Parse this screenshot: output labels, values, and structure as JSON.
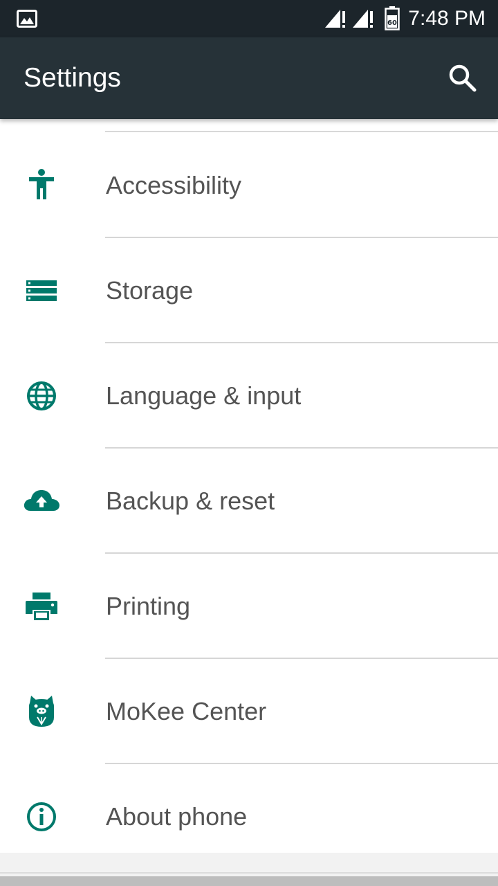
{
  "status_bar": {
    "time": "7:48 PM",
    "battery_label": "60",
    "icons": [
      "gallery-icon",
      "signal-no-data-icon",
      "signal-no-data-icon",
      "battery-icon"
    ]
  },
  "app_bar": {
    "title": "Settings",
    "search_icon": "search-icon"
  },
  "colors": {
    "status_bar": "#1c252b",
    "app_bar": "#263238",
    "icon_tint": "#00796b",
    "text": "#545454",
    "background": "#ffffff"
  },
  "settings": {
    "items": [
      {
        "label": "Accessibility",
        "icon": "accessibility-icon"
      },
      {
        "label": "Storage",
        "icon": "storage-icon"
      },
      {
        "label": "Language & input",
        "icon": "globe-icon"
      },
      {
        "label": "Backup & reset",
        "icon": "cloud-upload-icon"
      },
      {
        "label": "Printing",
        "icon": "printer-icon"
      },
      {
        "label": "MoKee Center",
        "icon": "mokee-icon"
      },
      {
        "label": "About phone",
        "icon": "info-icon"
      }
    ]
  }
}
